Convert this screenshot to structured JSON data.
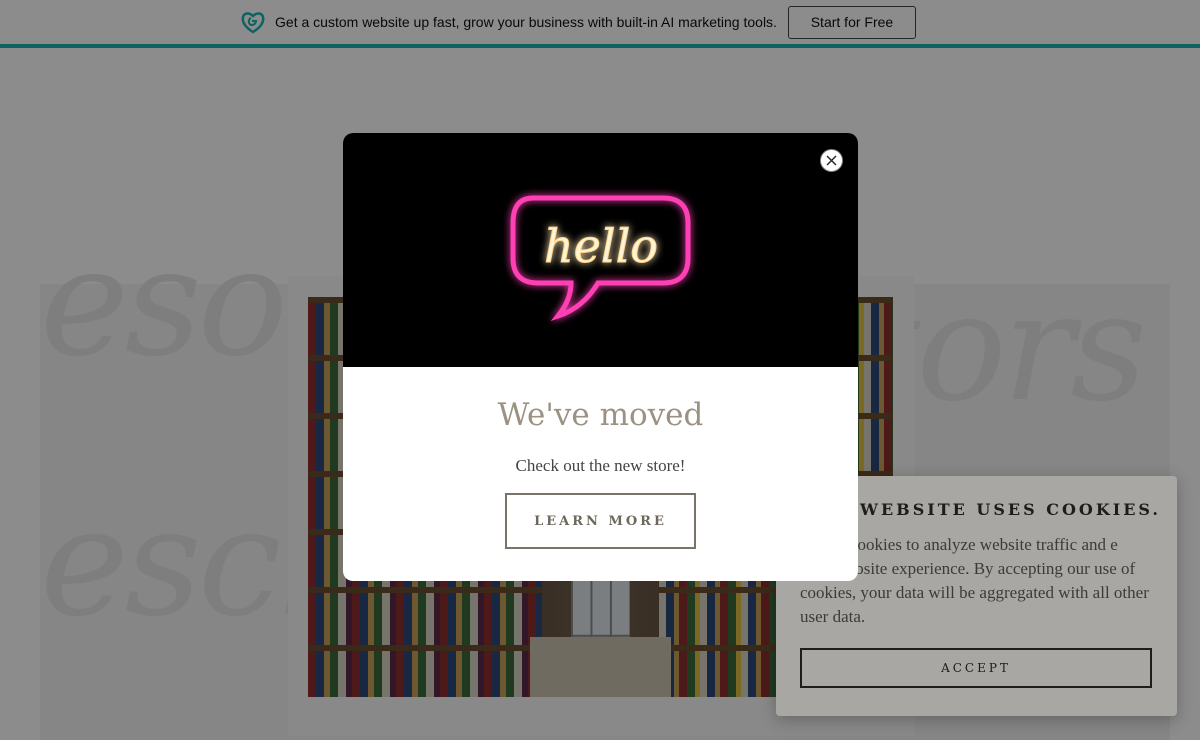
{
  "banner": {
    "logo_icon": "godaddy-heart-icon",
    "text": "Get a custom website up fast, grow your business with built-in AI marketing tools.",
    "cta_label": "Start for Free",
    "accent_color": "#1bb3b0"
  },
  "background": {
    "script_words": [
      "esou",
      "tors",
      "esch"
    ],
    "photo_icon": "bookshelf-aisle-photo"
  },
  "modal": {
    "hero_icon": "neon-hello-sign-icon",
    "hero_word": "hello",
    "title": "We've moved",
    "subtitle": "Check out the new store!",
    "button_label": "LEARN MORE",
    "close_icon": "close-icon"
  },
  "cookie": {
    "title": "WEBSITE USES COOKIES.",
    "body": "cookies to analyze website traffic and e your website experience. By accepting our use of cookies, your data will be aggregated with all other user data.",
    "accept_label": "ACCEPT"
  }
}
